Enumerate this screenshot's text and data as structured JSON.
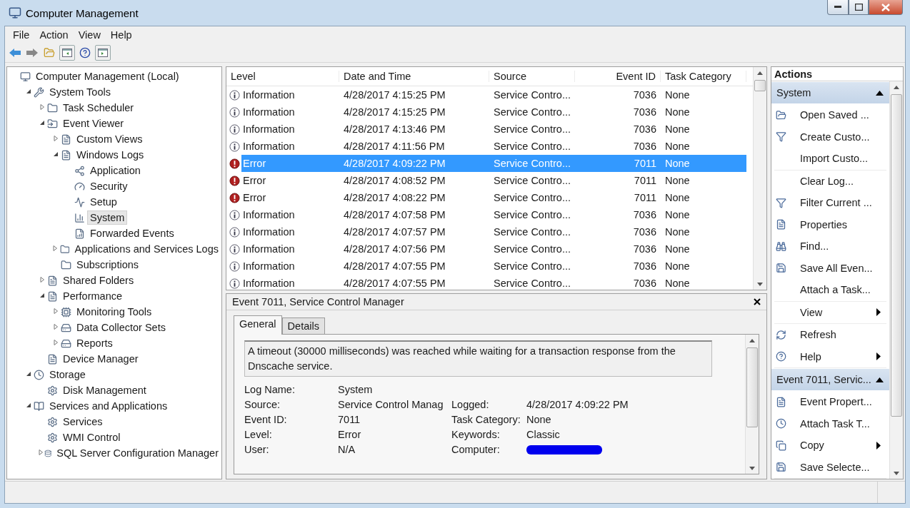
{
  "window": {
    "title": "Computer Management"
  },
  "menu": [
    "File",
    "Action",
    "View",
    "Help"
  ],
  "tree": [
    {
      "label": "Computer Management (Local)",
      "selected": false,
      "children": [
        {
          "label": "System Tools",
          "expanded": true,
          "selected": false,
          "children": [
            {
              "label": "Task Scheduler",
              "expanded": false,
              "selected": false
            },
            {
              "label": "Event Viewer",
              "expanded": true,
              "selected": false,
              "children": [
                {
                  "label": "Custom Views",
                  "expanded": false,
                  "selected": false
                },
                {
                  "label": "Windows Logs",
                  "expanded": true,
                  "selected": false,
                  "children": [
                    {
                      "label": "Application",
                      "selected": false
                    },
                    {
                      "label": "Security",
                      "selected": false
                    },
                    {
                      "label": "Setup",
                      "selected": false
                    },
                    {
                      "label": "System",
                      "selected": true
                    },
                    {
                      "label": "Forwarded Events",
                      "selected": false
                    }
                  ]
                },
                {
                  "label": "Applications and Services Logs",
                  "expanded": false,
                  "selected": false
                },
                {
                  "label": "Subscriptions",
                  "selected": false
                }
              ]
            },
            {
              "label": "Shared Folders",
              "expanded": false,
              "selected": false
            },
            {
              "label": "Performance",
              "expanded": true,
              "selected": false,
              "children": [
                {
                  "label": "Monitoring Tools",
                  "expanded": false,
                  "selected": false
                },
                {
                  "label": "Data Collector Sets",
                  "expanded": false,
                  "selected": false
                },
                {
                  "label": "Reports",
                  "expanded": false,
                  "selected": false
                }
              ]
            },
            {
              "label": "Device Manager",
              "selected": false
            }
          ]
        },
        {
          "label": "Storage",
          "expanded": true,
          "selected": false,
          "children": [
            {
              "label": "Disk Management",
              "selected": false
            }
          ]
        },
        {
          "label": "Services and Applications",
          "expanded": true,
          "selected": false,
          "children": [
            {
              "label": "Services",
              "selected": false
            },
            {
              "label": "WMI Control",
              "selected": false
            },
            {
              "label": "SQL Server Configuration Manager",
              "expanded": false,
              "selected": false
            }
          ]
        }
      ]
    }
  ],
  "table": {
    "columns": [
      "Level",
      "Date and Time",
      "Source",
      "Event ID",
      "Task Category"
    ],
    "rows": [
      {
        "kind": "information",
        "level": "Information",
        "date": "4/28/2017 4:15:25 PM",
        "source": "Service Contro...",
        "event_id": "7036",
        "task_category": "None",
        "selected": false
      },
      {
        "kind": "information",
        "level": "Information",
        "date": "4/28/2017 4:15:25 PM",
        "source": "Service Contro...",
        "event_id": "7036",
        "task_category": "None",
        "selected": false
      },
      {
        "kind": "information",
        "level": "Information",
        "date": "4/28/2017 4:13:46 PM",
        "source": "Service Contro...",
        "event_id": "7036",
        "task_category": "None",
        "selected": false
      },
      {
        "kind": "information",
        "level": "Information",
        "date": "4/28/2017 4:11:56 PM",
        "source": "Service Contro...",
        "event_id": "7036",
        "task_category": "None",
        "selected": false
      },
      {
        "kind": "error",
        "level": "Error",
        "date": "4/28/2017 4:09:22 PM",
        "source": "Service Contro...",
        "event_id": "7011",
        "task_category": "None",
        "selected": true
      },
      {
        "kind": "error",
        "level": "Error",
        "date": "4/28/2017 4:08:52 PM",
        "source": "Service Contro...",
        "event_id": "7011",
        "task_category": "None",
        "selected": false
      },
      {
        "kind": "error",
        "level": "Error",
        "date": "4/28/2017 4:08:22 PM",
        "source": "Service Contro...",
        "event_id": "7011",
        "task_category": "None",
        "selected": false
      },
      {
        "kind": "information",
        "level": "Information",
        "date": "4/28/2017 4:07:58 PM",
        "source": "Service Contro...",
        "event_id": "7036",
        "task_category": "None",
        "selected": false
      },
      {
        "kind": "information",
        "level": "Information",
        "date": "4/28/2017 4:07:57 PM",
        "source": "Service Contro...",
        "event_id": "7036",
        "task_category": "None",
        "selected": false
      },
      {
        "kind": "information",
        "level": "Information",
        "date": "4/28/2017 4:07:56 PM",
        "source": "Service Contro...",
        "event_id": "7036",
        "task_category": "None",
        "selected": false
      },
      {
        "kind": "information",
        "level": "Information",
        "date": "4/28/2017 4:07:55 PM",
        "source": "Service Contro...",
        "event_id": "7036",
        "task_category": "None",
        "selected": false
      },
      {
        "kind": "information",
        "level": "Information",
        "date": "4/28/2017 4:07:55 PM",
        "source": "Service Contro...",
        "event_id": "7036",
        "task_category": "None",
        "selected": false
      }
    ]
  },
  "details": {
    "title": "Event 7011, Service Control Manager",
    "tabs": [
      {
        "label": "General",
        "selected": true
      },
      {
        "label": "Details",
        "selected": false
      }
    ],
    "message": "A timeout (30000 milliseconds) was reached while waiting for a transaction response from the Dnscache service.",
    "rows": [
      {
        "label": "Log Name:",
        "value": "System"
      },
      {
        "label": "Source:",
        "value": "Service Control Manag",
        "label_2": "Logged:",
        "value_2": "4/28/2017 4:09:22 PM"
      },
      {
        "label": "Event ID:",
        "value": "7011",
        "label_2": "Task Category:",
        "value_2": "None"
      },
      {
        "label": "Level:",
        "value": "Error",
        "label_2": "Keywords:",
        "value_2": "Classic"
      },
      {
        "label": "User:",
        "value": "N/A",
        "label_2": "Computer:",
        "redacted": true
      }
    ]
  },
  "actions": {
    "title": "Actions",
    "sections": [
      {
        "title": "System",
        "expanded": true,
        "groups": [
          [
            {
              "label": "Open Saved ...",
              "submenu": false
            },
            {
              "label": "Create Custo...",
              "submenu": false
            },
            {
              "label": "Import Custo...",
              "submenu": false
            }
          ],
          [
            {
              "label": "Clear Log...",
              "submenu": false
            },
            {
              "label": "Filter Current ...",
              "submenu": false
            },
            {
              "label": "Properties",
              "submenu": false
            },
            {
              "label": "Find...",
              "submenu": false
            },
            {
              "label": "Save All Even...",
              "submenu": false
            },
            {
              "label": "Attach a Task...",
              "submenu": false
            }
          ],
          [
            {
              "label": "View",
              "submenu": true
            }
          ],
          [
            {
              "label": "Refresh",
              "submenu": false
            },
            {
              "label": "Help",
              "submenu": true
            }
          ]
        ]
      },
      {
        "title": "Event 7011, Servic...",
        "expanded": true,
        "groups": [
          [
            {
              "label": "Event Propert...",
              "submenu": false
            },
            {
              "label": "Attach Task T...",
              "submenu": false
            },
            {
              "label": "Copy",
              "submenu": true
            },
            {
              "label": "Save Selecte...",
              "submenu": false
            }
          ]
        ]
      }
    ]
  }
}
